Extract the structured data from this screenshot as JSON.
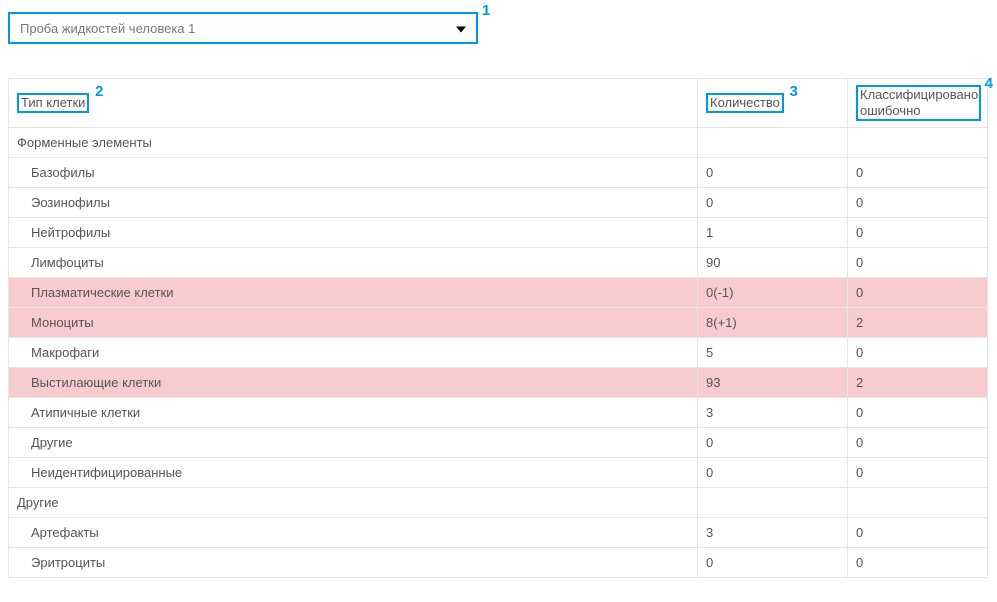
{
  "dropdown": {
    "selected": "Проба жидкостей человека 1"
  },
  "callouts": {
    "dropdown": "1",
    "col_type": "2",
    "col_qty": "3",
    "col_err": "4"
  },
  "columns": {
    "type": "Тип клетки",
    "qty": "Количество",
    "err": "Классифицировано ошибочно"
  },
  "rows": [
    {
      "label": "Форменные элементы",
      "qty": "",
      "err": "",
      "indent": 0,
      "hl": false
    },
    {
      "label": "Базофилы",
      "qty": "0",
      "err": "0",
      "indent": 1,
      "hl": false
    },
    {
      "label": "Эозинофилы",
      "qty": "0",
      "err": "0",
      "indent": 1,
      "hl": false
    },
    {
      "label": "Нейтрофилы",
      "qty": "1",
      "err": "0",
      "indent": 1,
      "hl": false
    },
    {
      "label": "Лимфоциты",
      "qty": "90",
      "err": "0",
      "indent": 1,
      "hl": false
    },
    {
      "label": "Плазматические клетки",
      "qty": "0(-1)",
      "err": "0",
      "indent": 1,
      "hl": true
    },
    {
      "label": "Моноциты",
      "qty": "8(+1)",
      "err": "2",
      "indent": 1,
      "hl": true
    },
    {
      "label": "Макрофаги",
      "qty": "5",
      "err": "0",
      "indent": 1,
      "hl": false
    },
    {
      "label": "Выстилающие клетки",
      "qty": "93",
      "err": "2",
      "indent": 1,
      "hl": true
    },
    {
      "label": "Атипичные клетки",
      "qty": "3",
      "err": "0",
      "indent": 1,
      "hl": false
    },
    {
      "label": "Другие",
      "qty": "0",
      "err": "0",
      "indent": 1,
      "hl": false
    },
    {
      "label": "Неидентифицированные",
      "qty": "0",
      "err": "0",
      "indent": 1,
      "hl": false
    },
    {
      "label": "Другие",
      "qty": "",
      "err": "",
      "indent": 0,
      "hl": false
    },
    {
      "label": "Артефакты",
      "qty": "3",
      "err": "0",
      "indent": 1,
      "hl": false
    },
    {
      "label": "Эритроциты",
      "qty": "0",
      "err": "0",
      "indent": 1,
      "hl": false
    }
  ]
}
